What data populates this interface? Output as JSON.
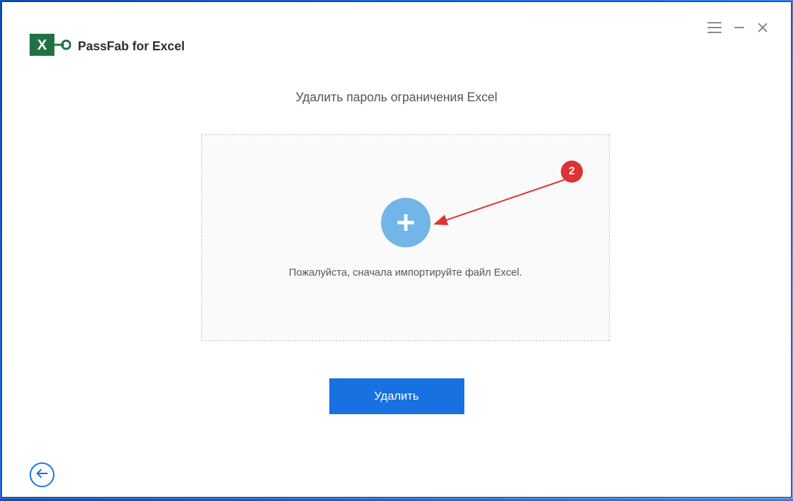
{
  "app": {
    "title": "PassFab for Excel"
  },
  "main": {
    "heading": "Удалить пароль ограничения Excel",
    "dropzone_text": "Пожалуйста, сначала импортируйте файл Excel.",
    "action_button_label": "Удалить"
  },
  "annotation": {
    "badge_number": "2"
  },
  "colors": {
    "primary": "#1871e1",
    "plus_circle": "#72b5e8",
    "excel_green": "#207245",
    "annotation_red": "#d33"
  }
}
